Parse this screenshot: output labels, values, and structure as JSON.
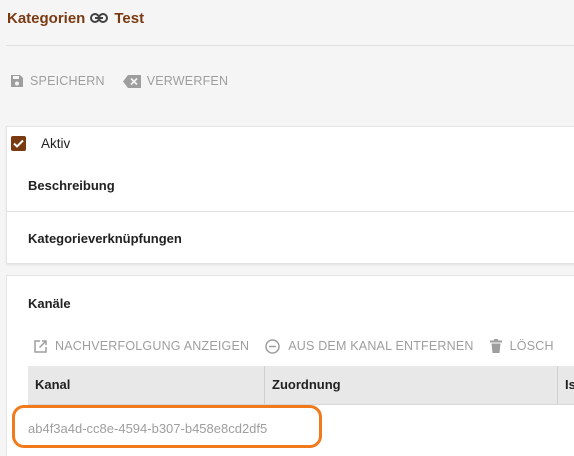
{
  "header": {
    "section": "Kategorien",
    "name": "Test",
    "link_icon": "link-icon"
  },
  "toolbar": {
    "save_label": "SPEICHERN",
    "discard_label": "VERWERFEN"
  },
  "form": {
    "active_label": "Aktiv",
    "active_checked": true,
    "description_label": "Beschreibung",
    "category_links_label": "Kategorieverknüpfungen"
  },
  "channels": {
    "title": "Kanäle",
    "actions": {
      "show_tracking": "NACHVERFOLGUNG ANZEIGEN",
      "remove_from_channel": "AUS DEM KANAL ENTFERNEN",
      "delete": "LÖSCH"
    },
    "columns": [
      "Kanal",
      "Zuordnung",
      "Ist"
    ],
    "rows": [
      {
        "channel_id": "ab4f3a4d-cc8e-4594-b307-b458e8cd2df5"
      }
    ]
  },
  "colors": {
    "brand": "#7a3a12",
    "highlight": "#f07a1c",
    "disabled": "#9e9e9e"
  }
}
